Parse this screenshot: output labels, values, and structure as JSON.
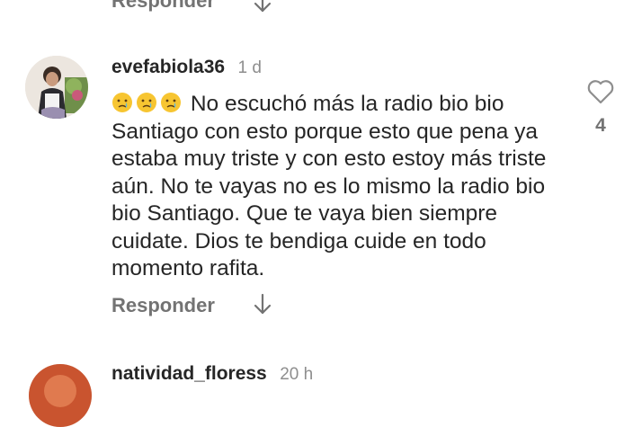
{
  "prev_comment": {
    "reply_label": "Responder"
  },
  "comment": {
    "username": "evefabiola36",
    "time": "1 d",
    "emoji_count": 3,
    "text": "No escuchó más la radio bio bio Santiago con esto porque esto que pena ya estaba muy triste y con esto estoy más triste aún. No te vayas no es lo mismo la radio bio bio Santiago. Que te vaya bien siempre cuidate. Dios te bendiga cuide en todo momento rafita.",
    "likes": "4",
    "reply_label": "Responder"
  },
  "next_comment": {
    "username": "natividad_floress",
    "time": "20 h"
  }
}
